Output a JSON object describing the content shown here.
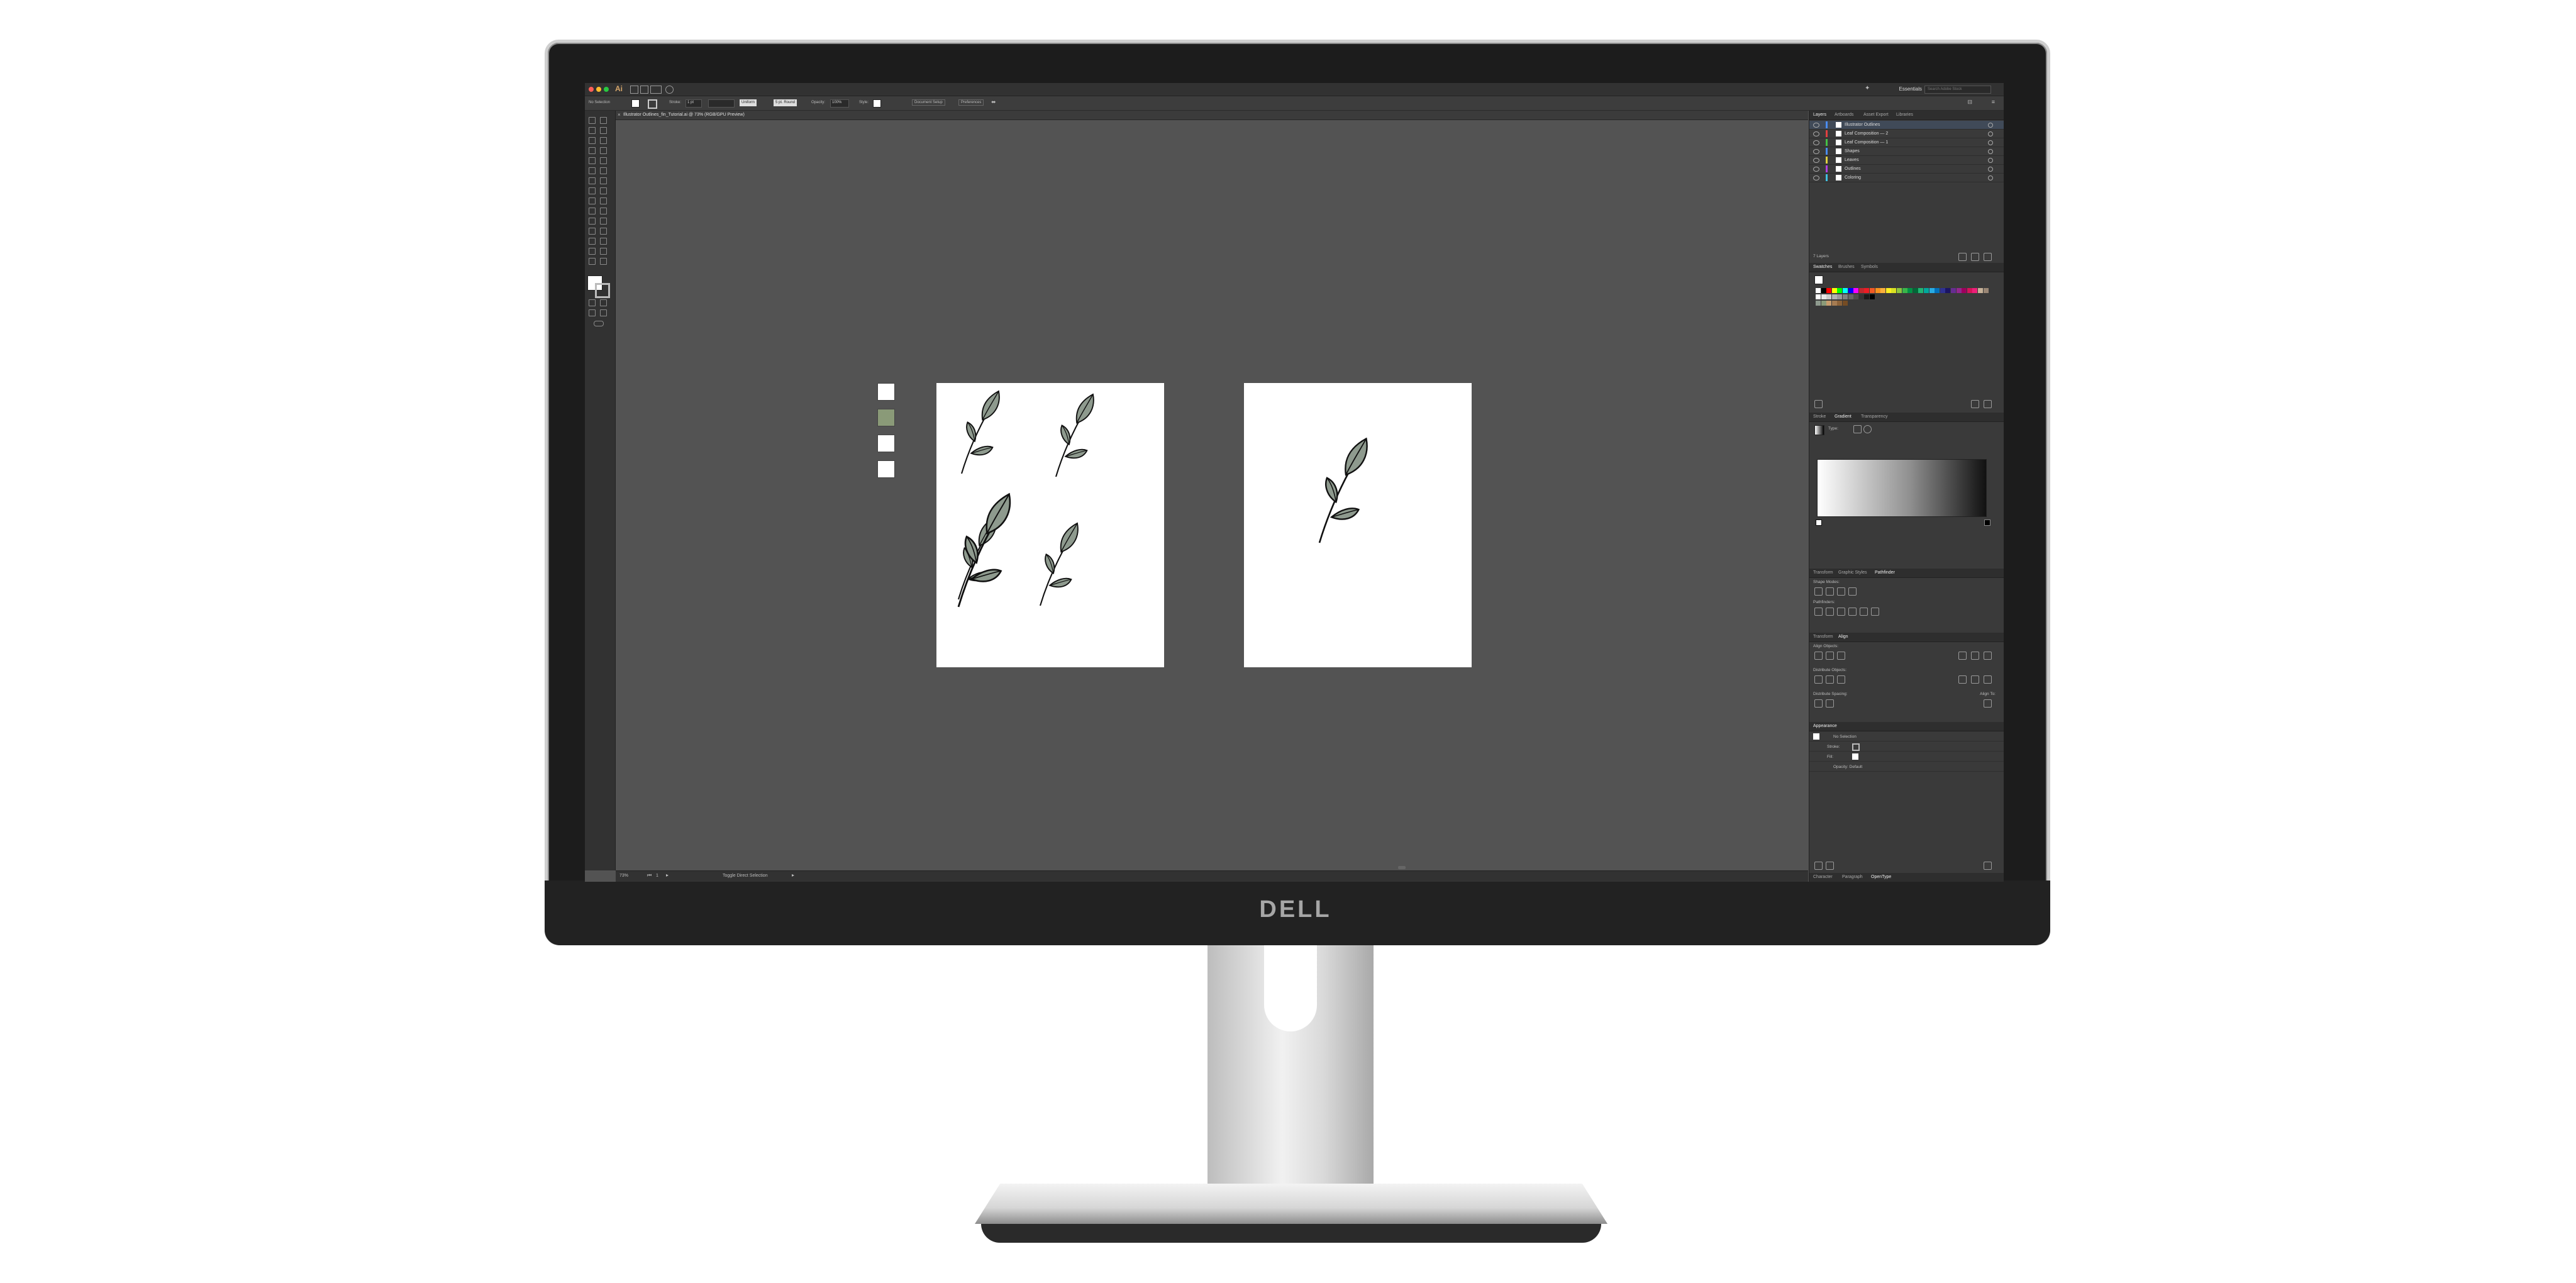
{
  "monitor": {
    "brand": "DELL"
  },
  "app": {
    "logo": "Ai",
    "workspace": "Essentials",
    "search_placeholder": "Search Adobe Stock"
  },
  "control_bar": {
    "selection": "No Selection",
    "stroke_label": "Stroke:",
    "stroke_value": "1 pt",
    "uniform": "Uniform",
    "basic": "5 pt. Round",
    "opacity_label": "Opacity:",
    "opacity_value": "100%",
    "style_label": "Style:",
    "document_setup": "Document Setup",
    "preferences": "Preferences"
  },
  "document": {
    "tab_title": "Illustrator Outlines_fin_Tutorial.ai @ 73% (RGB/GPU Preview)"
  },
  "artwork": {
    "swatches": [
      "#ffffff",
      "#8a9a78",
      "#ffffff",
      "#ffffff"
    ],
    "leaf_color": "#8e9a8e"
  },
  "status": {
    "zoom": "73%",
    "artboard": "1",
    "tool": "Toggle Direct Selection"
  },
  "panels": {
    "layers_tabs": [
      "Layers",
      "Artboards",
      "Asset Export",
      "Libraries"
    ],
    "layers": [
      {
        "name": "Illustrator Outlines",
        "color": "#4a8cf0",
        "selected": true
      },
      {
        "name": "Leaf Composition — 2",
        "color": "#e04040",
        "selected": false
      },
      {
        "name": "Leaf Composition — 1",
        "color": "#44c044",
        "selected": false
      },
      {
        "name": "Shapes",
        "color": "#4a8cf0",
        "selected": false
      },
      {
        "name": "Leaves",
        "color": "#e0d040",
        "selected": false
      },
      {
        "name": "Outlines",
        "color": "#b040e0",
        "selected": false
      },
      {
        "name": "Coloring",
        "color": "#40c0e0",
        "selected": false
      }
    ],
    "layers_count": "7 Layers",
    "swatches_tabs": [
      "Swatches",
      "Brushes",
      "Symbols"
    ],
    "gradient_tabs": [
      "Stroke",
      "Gradient",
      "Transparency"
    ],
    "gradient_type": "Type:",
    "pathfinder_tabs": [
      "Transform",
      "Graphic Styles",
      "Pathfinder"
    ],
    "shape_modes": "Shape Modes:",
    "pathfinders": "Pathfinders:",
    "align_tabs": [
      "Transform",
      "Align"
    ],
    "align_objects": "Align Objects:",
    "distribute_objects": "Distribute Objects:",
    "distribute_spacing": "Distribute Spacing:",
    "align_to": "Align To:",
    "appearance_title": "Appearance",
    "appearance_selection": "No Selection",
    "appearance_stroke": "Stroke:",
    "appearance_fill": "Fill:",
    "appearance_opacity": "Opacity: Default",
    "bottom_tabs": [
      "Character",
      "Paragraph",
      "OpenType"
    ]
  }
}
